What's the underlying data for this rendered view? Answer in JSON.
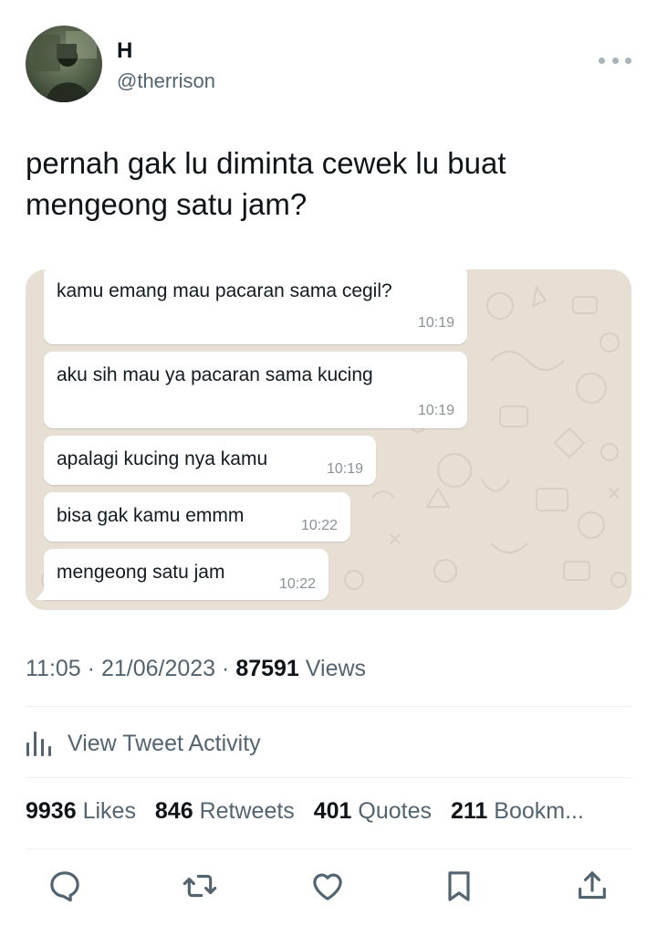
{
  "author": {
    "name": "H",
    "handle": "@therrison",
    "avatar_icon": "profile-photo-icon"
  },
  "tweet": {
    "text_line1": "pernah gak lu diminta cewek lu buat",
    "text_line2": "mengeong satu jam?"
  },
  "chat": {
    "messages": [
      {
        "text": "kamu emang mau pacaran sama cegil?",
        "time": "10:19"
      },
      {
        "text": "aku sih mau ya pacaran sama kucing",
        "time": "10:19"
      },
      {
        "text": "apalagi kucing nya kamu",
        "time": "10:19"
      },
      {
        "text": "bisa gak kamu emmm",
        "time": "10:22"
      },
      {
        "text": "mengeong satu jam",
        "time": "10:22"
      }
    ]
  },
  "meta": {
    "time": "11:05",
    "date": "21/06/2023",
    "views_count": "87591",
    "views_label": "Views",
    "separator": "·"
  },
  "activity": {
    "label": "View Tweet Activity",
    "icon": "analytics-bars-icon"
  },
  "stats": {
    "likes_count": "9936",
    "likes_label": "Likes",
    "retweets_count": "846",
    "retweets_label": "Retweets",
    "quotes_count": "401",
    "quotes_label": "Quotes",
    "bookmarks_count": "211",
    "bookmarks_label": "Bookm..."
  },
  "actions": [
    "reply-icon",
    "retweet-icon",
    "like-icon",
    "bookmark-icon",
    "share-icon"
  ],
  "colors": {
    "text_primary": "#0f1419",
    "text_secondary": "#536471",
    "chat_wallpaper": "#e7ded4",
    "bubble": "#ffffff",
    "divider": "#eff3f4"
  }
}
